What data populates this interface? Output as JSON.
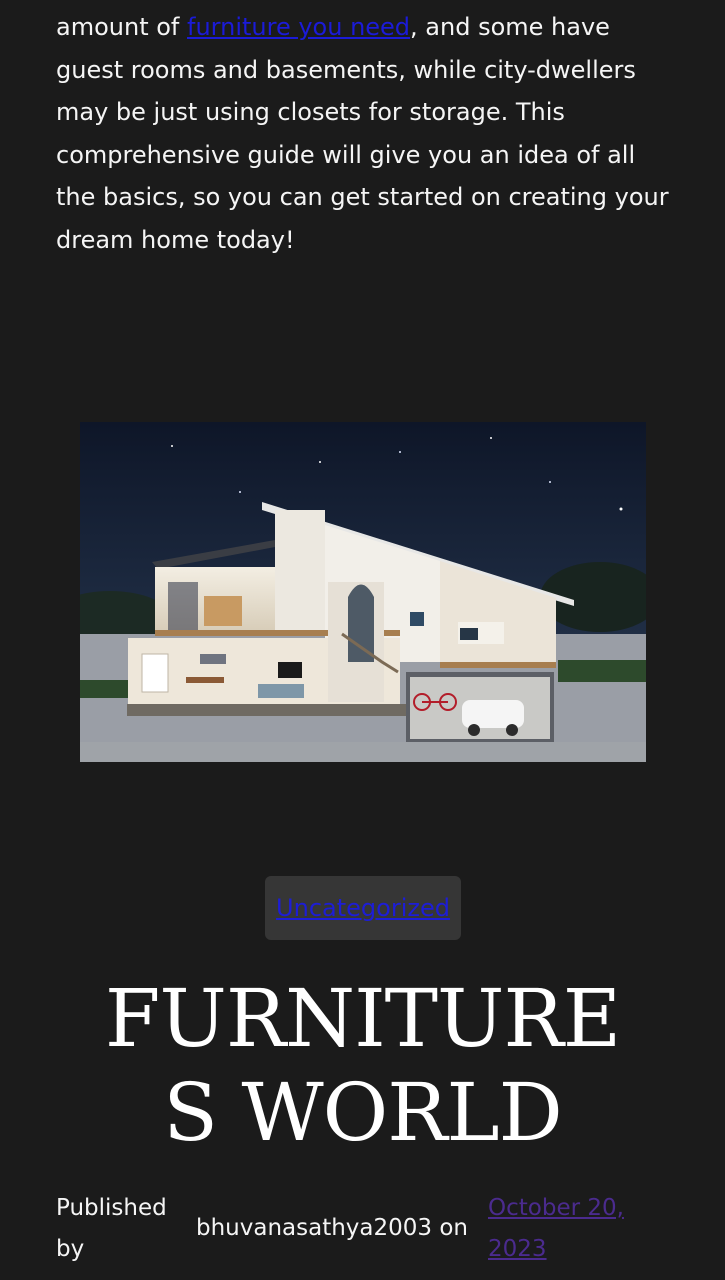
{
  "article": {
    "intro_before_link": "amount of ",
    "link_text": "furniture you need",
    "intro_after_link": ", and some have guest rooms and basements, while city-dwellers may be just using closets for storage. This comprehensive guide will give you an idea of all the basics, so you can get started on creating your dream home today!"
  },
  "category": {
    "label": "Uncategorized"
  },
  "post": {
    "title_line1": "FURNITURE",
    "title_line2": "S WORLD"
  },
  "meta": {
    "published_label": "Published by",
    "author_text": "bhuvanasathya2003 on",
    "date_text": "October 20, 2023"
  },
  "colors": {
    "background": "#1b1b1b",
    "link": "#1b1bd8",
    "visited_link": "#4b2b8e",
    "pill_bg": "#363636"
  }
}
